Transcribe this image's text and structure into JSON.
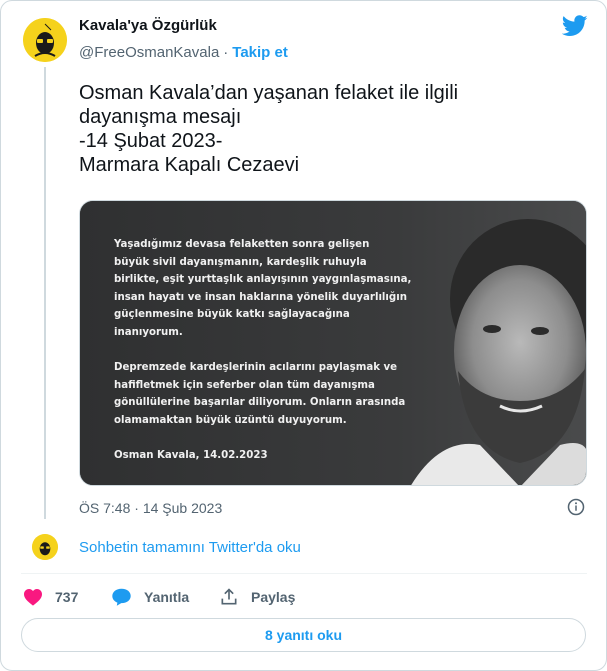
{
  "author": {
    "name": "Kavala'ya Özgürlük",
    "handle": "@FreeOsmanKavala",
    "separator": "·",
    "follow_label": "Takip et",
    "avatar_text": "OSMAN KAVALA"
  },
  "tweet": {
    "lines": [
      "Osman Kavala’dan yaşanan felaket ile ilgili",
      "dayanışma mesajı",
      "-14 Şubat 2023-",
      "Marmara Kapalı Cezaevi"
    ],
    "time": "ÖS 7:48",
    "date": "14 Şub 2023",
    "meta_separator": "·"
  },
  "media": {
    "letter_paragraphs": [
      [
        "Yaşadığımız devasa felaketten sonra gelişen",
        "büyük sivil dayanışmanın, kardeşlik ruhuyla",
        "birlikte, eşit yurttaşlık anlayışının yaygınlaşmasına,",
        "insan hayatı ve insan haklarına yönelik duyarlılığın",
        "güçlenmesine büyük katkı sağlayacağına",
        "inanıyorum."
      ],
      [
        "Depremzede kardeşlerinin acılarını paylaşmak ve",
        "hafifletmek için seferber olan tüm dayanışma",
        "gönüllülerine başarılar diliyorum. Onların arasında",
        "olamamaktan büyük üzüntü duyuyorum."
      ],
      [
        "Osman Kavala, 14.02.2023"
      ]
    ]
  },
  "conversation": {
    "link_label": "Sohbetin tamamını Twitter'da oku"
  },
  "actions": {
    "like_count": "737",
    "reply_label": "Yanıtla",
    "share_label": "Paylaş"
  },
  "read_replies_label": "8 yanıtı oku",
  "colors": {
    "accent": "#1d9bf0",
    "like": "#f91880",
    "muted": "#536471",
    "avatar_bg": "#f5d21c"
  }
}
